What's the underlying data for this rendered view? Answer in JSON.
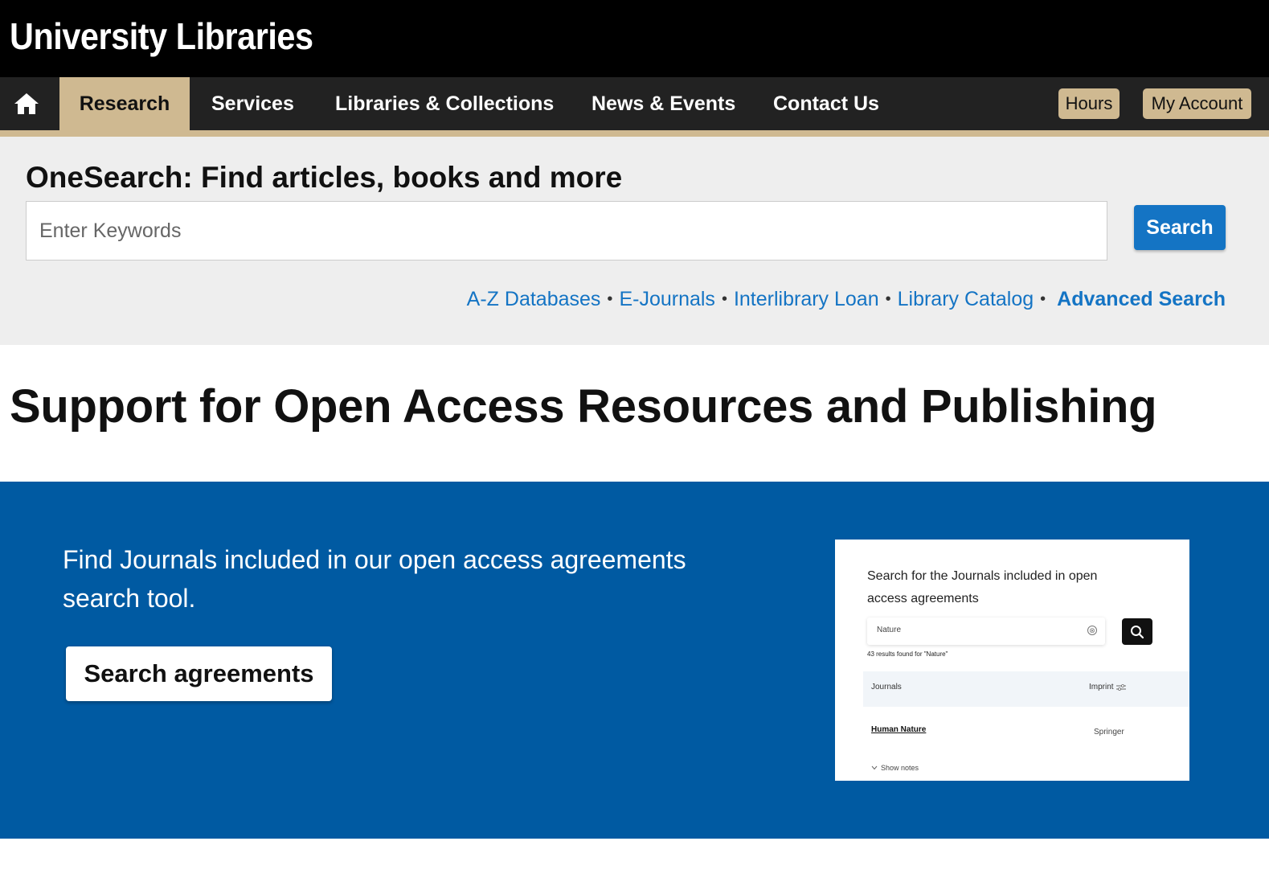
{
  "header": {
    "title": "University Libraries"
  },
  "nav": {
    "home_icon": "home-icon",
    "items": [
      {
        "label": "Research",
        "active": true
      },
      {
        "label": "Services",
        "active": false
      },
      {
        "label": "Libraries & Collections",
        "active": false
      },
      {
        "label": "News & Events",
        "active": false
      },
      {
        "label": "Contact Us",
        "active": false
      }
    ],
    "utility": {
      "hours": "Hours",
      "account": "My Account"
    }
  },
  "search": {
    "heading": "OneSearch: Find articles, books and more",
    "placeholder": "Enter Keywords",
    "button": "Search",
    "links": [
      "A-Z Databases",
      "E-Journals",
      "Interlibrary Loan",
      "Library Catalog"
    ],
    "advanced": "Advanced Search",
    "separator": "•"
  },
  "page": {
    "title": "Support for Open Access Resources and Publishing"
  },
  "feature": {
    "text": "Find Journals included in our open access agreements search tool.",
    "button": "Search agreements",
    "preview": {
      "title": "Search for the Journals included in open access agreements",
      "search_value": "Nature",
      "clear_icon": "⊗",
      "results": "43 results found for \"Nature\"",
      "col_journals": "Journals",
      "col_imprint": "Imprint",
      "row_journal": "Human Nature",
      "row_imprint": "Springer",
      "show_notes": "Show notes"
    }
  },
  "colors": {
    "brand_black": "#000000",
    "nav_bg": "#222222",
    "gold": "#cfb991",
    "link_blue": "#1474c4",
    "feature_blue": "#005aa2"
  }
}
